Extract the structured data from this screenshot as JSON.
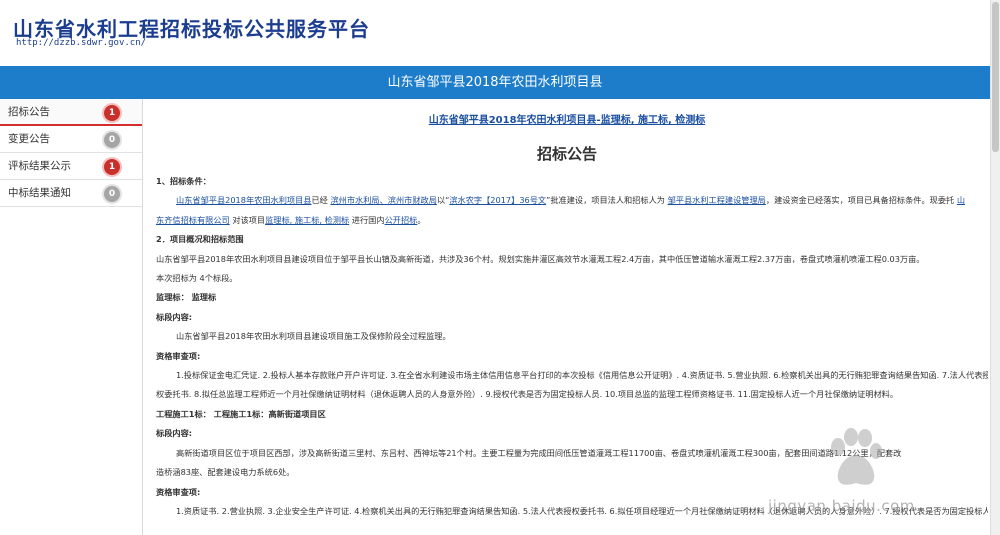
{
  "header": {
    "site_title": "山东省水利工程招标投标公共服务平台",
    "site_url": "http://dzzb.sdwr.gov.cn/"
  },
  "title_bar": {
    "text": "山东省邹平县2018年农田水利项目县"
  },
  "sidebar": {
    "items": [
      {
        "label": "招标公告",
        "count": "1",
        "badge_color": "#c9302c"
      },
      {
        "label": "变更公告",
        "count": "0",
        "badge_color": "#a5a5a5"
      },
      {
        "label": "评标结果公示",
        "count": "1",
        "badge_color": "#c9302c"
      },
      {
        "label": "中标结果通知",
        "count": "0",
        "badge_color": "#a5a5a5"
      }
    ]
  },
  "content": {
    "project_link": "山东省邹平县2018年农田水利项目县-监理标, 施工标, 检测标",
    "heading": "招标公告",
    "s1_title": "1、招标条件：",
    "s1_l1_a": "山东省邹平县2018年农田水利项目县",
    "s1_l1_b": "已经",
    "s1_l1_c": "滨州市水利局、滨州市财政局",
    "s1_l1_d": "以“",
    "s1_l1_e": "滨水农字【2017】36号文",
    "s1_l1_f": "”批准建设，项目法人和招标人为",
    "s1_l1_g": "邹平县水利工程建设管理局",
    "s1_l1_h": "，建设资金已经落实，项目已具备招标条件。现委托",
    "s1_l1_i": "山",
    "s1_l2_a": "东齐信招标有限公司",
    "s1_l2_b": "对该项目",
    "s1_l2_c": "监理标, 施工标, 检测标",
    "s1_l2_d": "进行国内",
    "s1_l2_e": "公开招标",
    "s1_l2_f": "。",
    "s2_title": "2．项目概况和招标范围",
    "s2_p1": "山东省邹平县2018年农田水利项目县建设项目位于邹平县长山镇及高新街道，共涉及36个村。规划实施井灌区高效节水灌溉工程2.4万亩，其中低压管道输水灌溉工程2.37万亩，卷盘式喷灌机喷灌工程0.03万亩。",
    "s2_p2": "本次招标为 4个标段。",
    "lot1": "监理标： 监理标",
    "lot1_scope_label": "标段内容:",
    "lot1_scope": "山东省邹平县2018年农田水利项目县建设项目施工及保修阶段全过程监理。",
    "lot1_qual_label": "资格审查项:",
    "lot1_qual_l1": "1.投标保证金电汇凭证. 2.投标人基本存款账户开户许可证. 3.在全省水利建设市场主体信用信息平台打印的本次投标《信用信息公开证明》. 4.资质证书. 5.营业执照. 6.检察机关出具的无行贿犯罪查询结果告知函. 7.法人代表授",
    "lot1_qual_l2": "权委托书. 8.拟任总监理工程师近一个月社保缴纳证明材料（退休返聘人员的人身意外险）. 9.授权代表是否为固定投标人员. 10.项目总监的监理工程师资格证书. 11.固定投标人近一个月社保缴纳证明材料。",
    "lot2": "工程施工1标：  工程施工1标：高新街道项目区",
    "lot2_scope_label": "标段内容:",
    "lot2_scope_l1": "高新街道项目区位于项目区西部，涉及高新街道三里村、东吕村、西神坛等21个村。主要工程量为完成田间低压管道灌溉工程11700亩、卷盘式喷灌机灌溉工程300亩，配套田间道路1.12公里，配套改",
    "lot2_scope_l2": "造桥涵83座、配套建设电力系统6处。",
    "lot2_qual_label": "资格审查项:",
    "lot2_qual_l1": "1.资质证书. 2.营业执照. 3.企业安全生产许可证. 4.检察机关出具的无行贿犯罪查询结果告知函. 5.法人代表授权委托书. 6.拟任项目经理近一个月社保缴纳证明材料（退休返聘人员的人身意外险）. 7.授权代表是否为固定投标人"
  },
  "watermark": {
    "text": "jingyan.baidu.com",
    "icon": "baidu-paw-icon"
  }
}
